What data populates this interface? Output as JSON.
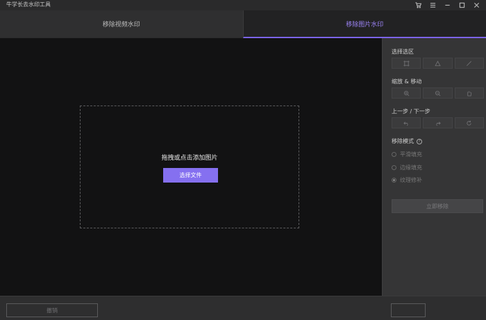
{
  "app": {
    "title": "牛学长去水印工具"
  },
  "window_controls": [
    "cart-icon",
    "menu-icon",
    "minimize-icon",
    "maximize-icon",
    "close-icon"
  ],
  "tabs": [
    {
      "label": "移除视频水印",
      "active": false
    },
    {
      "label": "移除图片水印",
      "active": true
    }
  ],
  "canvas": {
    "prompt": "拖拽或点击添加图片",
    "choose_label": "选择文件"
  },
  "sidebar": {
    "select_area_label": "选择选区",
    "zoom_move_label": "缩放 & 移动",
    "undo_redo_label": "上一步 / 下一步",
    "mode_label": "移除模式",
    "modes": [
      {
        "label": "平滑填充",
        "checked": false
      },
      {
        "label": "边缘填充",
        "checked": false
      },
      {
        "label": "纹理修补",
        "checked": true
      }
    ],
    "remove_label": "立即移除"
  },
  "bottom": {
    "undo_label": "撤销"
  },
  "colors": {
    "accent": "#8570f0",
    "active_tab_text": "#9a82f2"
  }
}
